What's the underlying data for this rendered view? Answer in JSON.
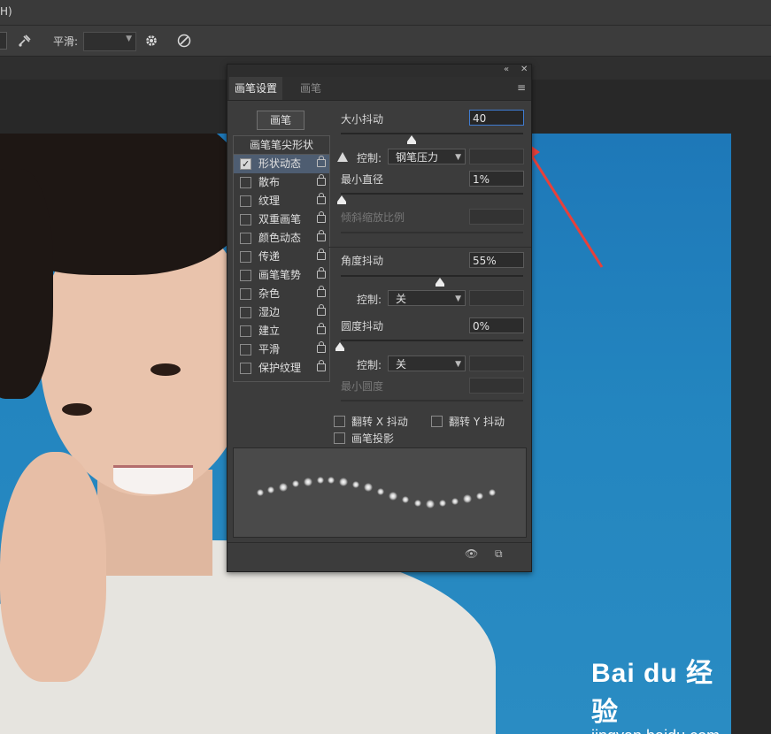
{
  "menubar": {
    "partial_text": "H)"
  },
  "options_bar": {
    "smooth_label": "平滑:"
  },
  "panel": {
    "tabs": [
      {
        "label": "画笔设置",
        "active": true
      },
      {
        "label": "画笔",
        "active": false
      }
    ],
    "brush_button": "画笔",
    "tip_shape_header": "画笔笔尖形状",
    "items": [
      {
        "label": "形状动态",
        "checked": true,
        "selected": true
      },
      {
        "label": "散布",
        "checked": false
      },
      {
        "label": "纹理",
        "checked": false
      },
      {
        "label": "双重画笔",
        "checked": false
      },
      {
        "label": "颜色动态",
        "checked": false
      },
      {
        "label": "传递",
        "checked": false
      },
      {
        "label": "画笔笔势",
        "checked": false
      },
      {
        "label": "杂色",
        "checked": false
      },
      {
        "label": "湿边",
        "checked": false
      },
      {
        "label": "建立",
        "checked": false
      },
      {
        "label": "平滑",
        "checked": false
      },
      {
        "label": "保护纹理",
        "checked": false
      }
    ],
    "size_jitter": {
      "label": "大小抖动",
      "value": "40"
    },
    "control1": {
      "label": "控制:",
      "value": "钢笔压力"
    },
    "min_diameter": {
      "label": "最小直径",
      "value": "1%"
    },
    "tilt_scale": {
      "label": "倾斜缩放比例"
    },
    "angle_jitter": {
      "label": "角度抖动",
      "value": "55%"
    },
    "control2": {
      "label": "控制:",
      "value": "关"
    },
    "roundness_jitter": {
      "label": "圆度抖动",
      "value": "0%"
    },
    "control3": {
      "label": "控制:",
      "value": "关"
    },
    "min_roundness": {
      "label": "最小圆度"
    },
    "flip_x": "翻转 X 抖动",
    "flip_y": "翻转 Y 抖动",
    "brush_projection": "画笔投影"
  },
  "watermark": {
    "logo": "Bai du 经验",
    "url": "jingyan.baidu.com"
  },
  "colors": {
    "accent_focus": "#3f7cd1",
    "arrow": "#e8403a",
    "selected_row": "#4e5d71"
  }
}
